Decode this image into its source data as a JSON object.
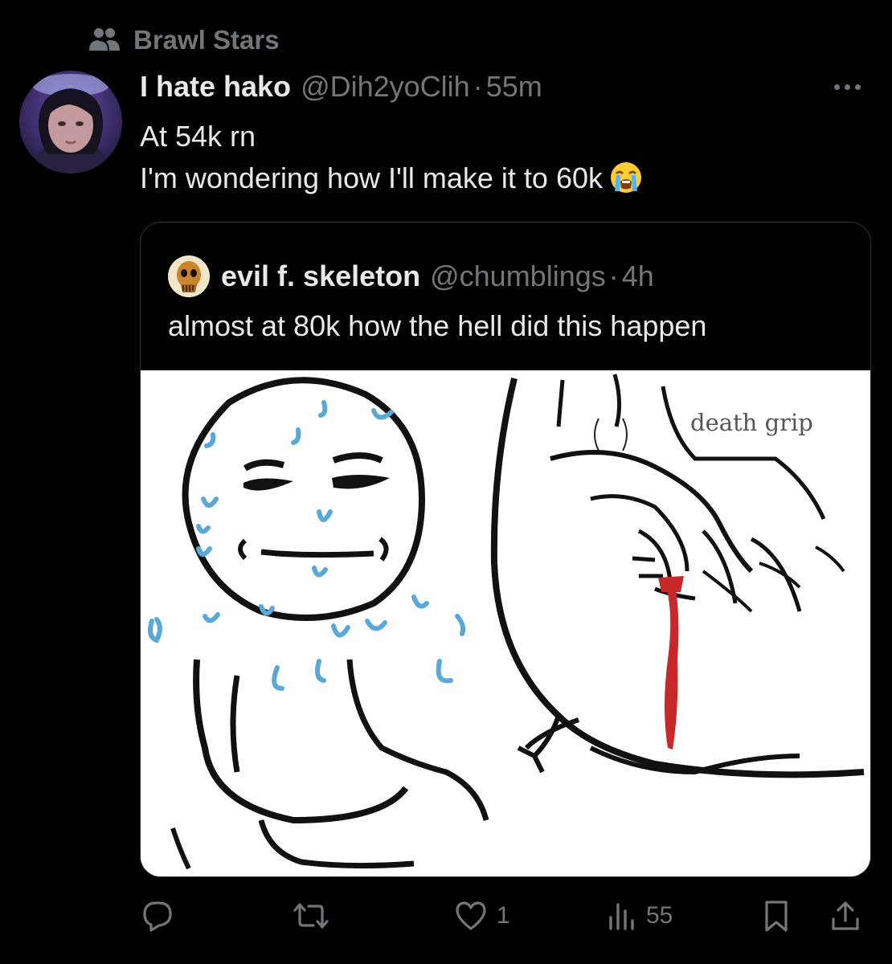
{
  "community": {
    "name": "Brawl Stars",
    "icon": "community-icon"
  },
  "post": {
    "display_name": "I hate hako",
    "handle": "@Dih2yoClih",
    "separator": "·",
    "time": "55m",
    "more_icon": "more-icon",
    "text_line1": "At 54k rn",
    "text_line2": "I'm wondering how I'll make it to 60k",
    "emoji": "loudly-crying-face"
  },
  "quote": {
    "display_name": "evil f. skeleton",
    "handle": "@chumblings",
    "separator": "·",
    "time": "4h",
    "text": "almost at 80k how the hell did this happen",
    "image_caption": "death grip"
  },
  "actions": {
    "reply": {
      "icon": "reply-icon",
      "count": ""
    },
    "repost": {
      "icon": "repost-icon",
      "count": ""
    },
    "like": {
      "icon": "heart-icon",
      "count": "1"
    },
    "views": {
      "icon": "views-icon",
      "count": "55"
    },
    "bookmark": {
      "icon": "bookmark-icon"
    },
    "share": {
      "icon": "share-icon"
    }
  },
  "colors": {
    "background": "#000000",
    "text_primary": "#e7e9ea",
    "text_secondary": "#71767b",
    "border": "#2f3336",
    "sweat": "#5aa8d8",
    "blood": "#c8282a"
  }
}
